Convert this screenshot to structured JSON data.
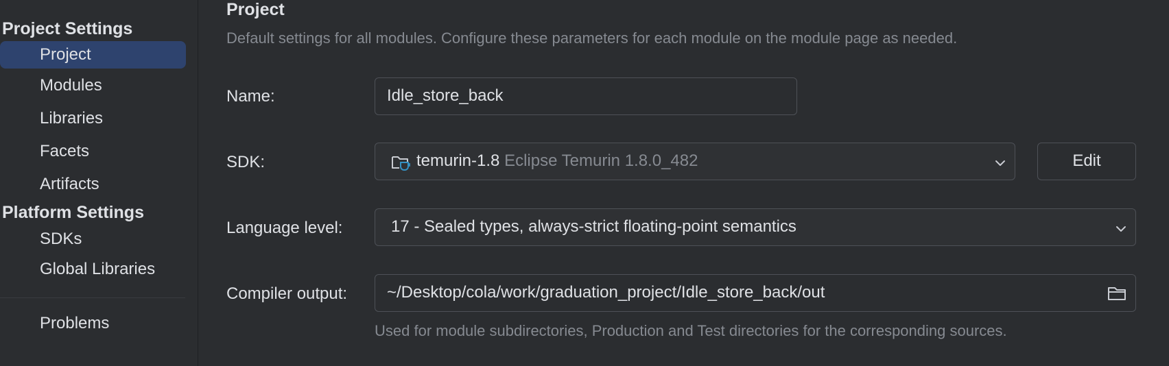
{
  "sidebar": {
    "project_settings_title": "Project Settings",
    "project_items": [
      {
        "label": "Project",
        "selected": true
      },
      {
        "label": "Modules"
      },
      {
        "label": "Libraries"
      },
      {
        "label": "Facets"
      },
      {
        "label": "Artifacts"
      }
    ],
    "platform_settings_title": "Platform Settings",
    "platform_items": [
      {
        "label": "SDKs"
      },
      {
        "label": "Global Libraries"
      }
    ],
    "problems_label": "Problems"
  },
  "main": {
    "title": "Project",
    "description": "Default settings for all modules. Configure these parameters for each module on the module page as needed.",
    "name": {
      "label": "Name:",
      "value": "Idle_store_back"
    },
    "sdk": {
      "label": "SDK:",
      "name": "temurin-1.8",
      "detail": "Eclipse Temurin 1.8.0_482",
      "icon": "jdk-folder-icon",
      "edit_label": "Edit"
    },
    "language_level": {
      "label": "Language level:",
      "value": "17 - Sealed types, always-strict floating-point semantics"
    },
    "compiler_output": {
      "label": "Compiler output:",
      "value": "~/Desktop/cola/work/graduation_project/Idle_store_back/out",
      "icon": "folder-icon",
      "hint": "Used for module subdirectories, Production and Test directories for the corresponding sources."
    }
  },
  "colors": {
    "background": "#2b2d30",
    "selection": "#2e436e",
    "text": "#dfe1e5",
    "muted_text": "#868a91",
    "border": "#4e5157",
    "icon_accent": "#3592c4"
  }
}
